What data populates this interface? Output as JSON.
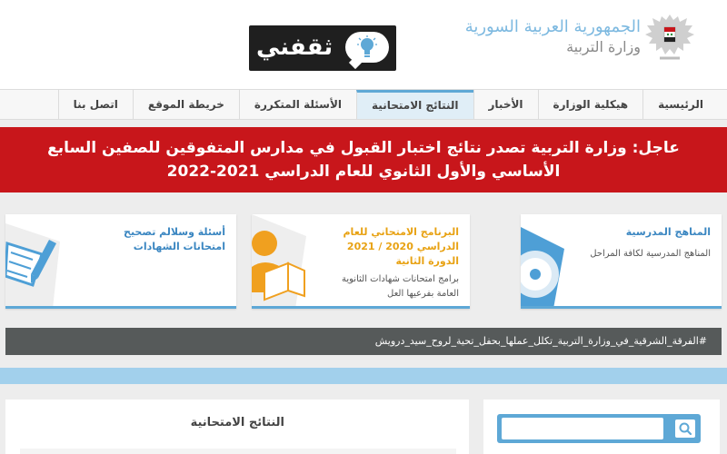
{
  "header": {
    "gov_title": "الجمهورية العربية السورية",
    "ministry": "وزارة التربية",
    "logo_text": "ثقفني"
  },
  "nav": {
    "items": [
      {
        "label": "الرئيسية"
      },
      {
        "label": "هيكلية الوزارة"
      },
      {
        "label": "الأخبار"
      },
      {
        "label": "النتائج الامتحانية",
        "active": true
      },
      {
        "label": "الأسئلة المتكررة"
      },
      {
        "label": "خريطة الموقع"
      },
      {
        "label": "اتصل بنا"
      }
    ]
  },
  "breaking": {
    "label": "عاجل:",
    "text": "وزارة التربية تصدر نتائج اختبار القبول في مدارس المتفوقين للصفين السابع الأساسي والأول الثانوي للعام الدراسي 2021-2022"
  },
  "cards": [
    {
      "title": "المناهج المدرسية",
      "desc": "المناهج المدرسية لكافة المراحل",
      "title_color": "#3a86c1"
    },
    {
      "title": "البرنامج الامتحاني للعام الدراسي 2020 / 2021 الدورة الثانية",
      "desc": "برامج امتحانات شهادات الثانوية العامة بفرعيها العل",
      "title_color": "#e8a213"
    },
    {
      "title": "أسئلة وسلالم تصحيح امتحانات الشهادات",
      "desc": "",
      "title_color": "#3a86c1"
    }
  ],
  "ticker": {
    "text": "#الفرقة_الشرقية_في_وزارة_التربية_تكلل_عملها_بحفل_تحية_لروح_سيد_درويش"
  },
  "results_panel": {
    "title": "النتائج الامتحانية"
  },
  "search": {
    "placeholder": "",
    "icon": "search-icon"
  },
  "colors": {
    "accent": "#5ea8d6",
    "breaking": "#c8161b",
    "ticker": "#565a5a"
  }
}
